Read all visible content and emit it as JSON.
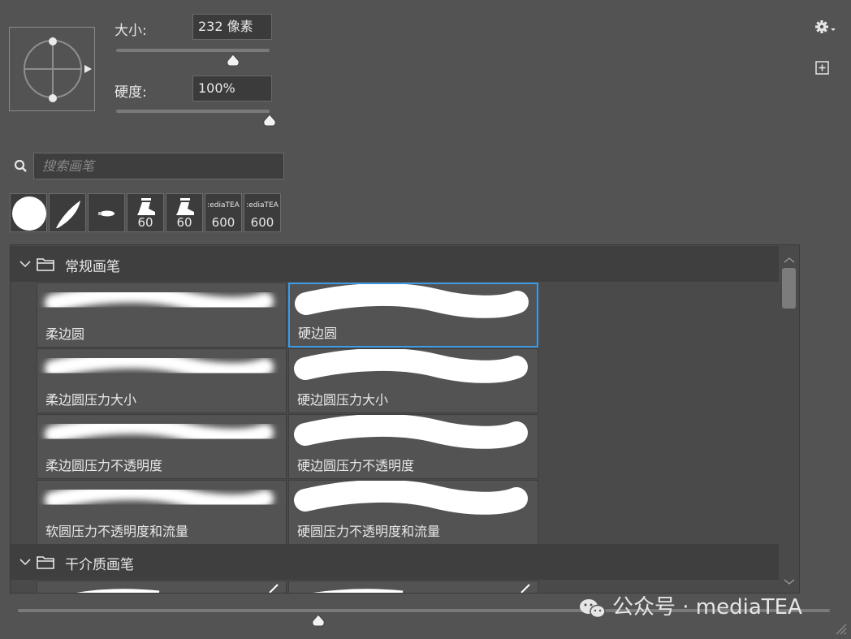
{
  "brush_settings": {
    "size_label": "大小:",
    "size_value": "232 像素",
    "size_fraction": 0.76,
    "hardness_label": "硬度:",
    "hardness_value": "100%",
    "hardness_fraction": 1.0
  },
  "toolbar": {
    "settings_icon": "gear-icon",
    "new_brush_icon": "plus-square-icon"
  },
  "search": {
    "placeholder": "搜索画笔"
  },
  "recent_brushes": [
    {
      "kind": "round-icon",
      "label": ""
    },
    {
      "kind": "feather-icon",
      "label": ""
    },
    {
      "kind": "bullet-icon",
      "label": ""
    },
    {
      "kind": "stamp-icon",
      "label": "60"
    },
    {
      "kind": "stamp-icon",
      "label": "60"
    },
    {
      "kind": "kyle-text",
      "tiny": ":ediaTEA",
      "label": "600"
    },
    {
      "kind": "kyle-text",
      "tiny": ":ediaTEA",
      "label": "600"
    }
  ],
  "groups": [
    {
      "name": "常规画笔",
      "brushes": [
        {
          "name": "柔边圆",
          "style": "soft"
        },
        {
          "name": "硬边圆",
          "style": "hard",
          "selected": true
        },
        {
          "name": "柔边圆压力大小",
          "style": "soft"
        },
        {
          "name": "硬边圆压力大小",
          "style": "hard"
        },
        {
          "name": "柔边圆压力不透明度",
          "style": "soft"
        },
        {
          "name": "硬边圆压力不透明度",
          "style": "hard"
        },
        {
          "name": "软圆压力不透明度和流量",
          "style": "soft"
        },
        {
          "name": "硬圆压力不透明度和流量",
          "style": "hard"
        }
      ]
    },
    {
      "name": "干介质画笔",
      "brushes": []
    }
  ],
  "preview_size_fraction": 0.37,
  "watermark": "公众号 · mediaTEA",
  "colors": {
    "background": "#535353",
    "selection": "#3d9be6",
    "group_header": "#3f3f3f"
  }
}
